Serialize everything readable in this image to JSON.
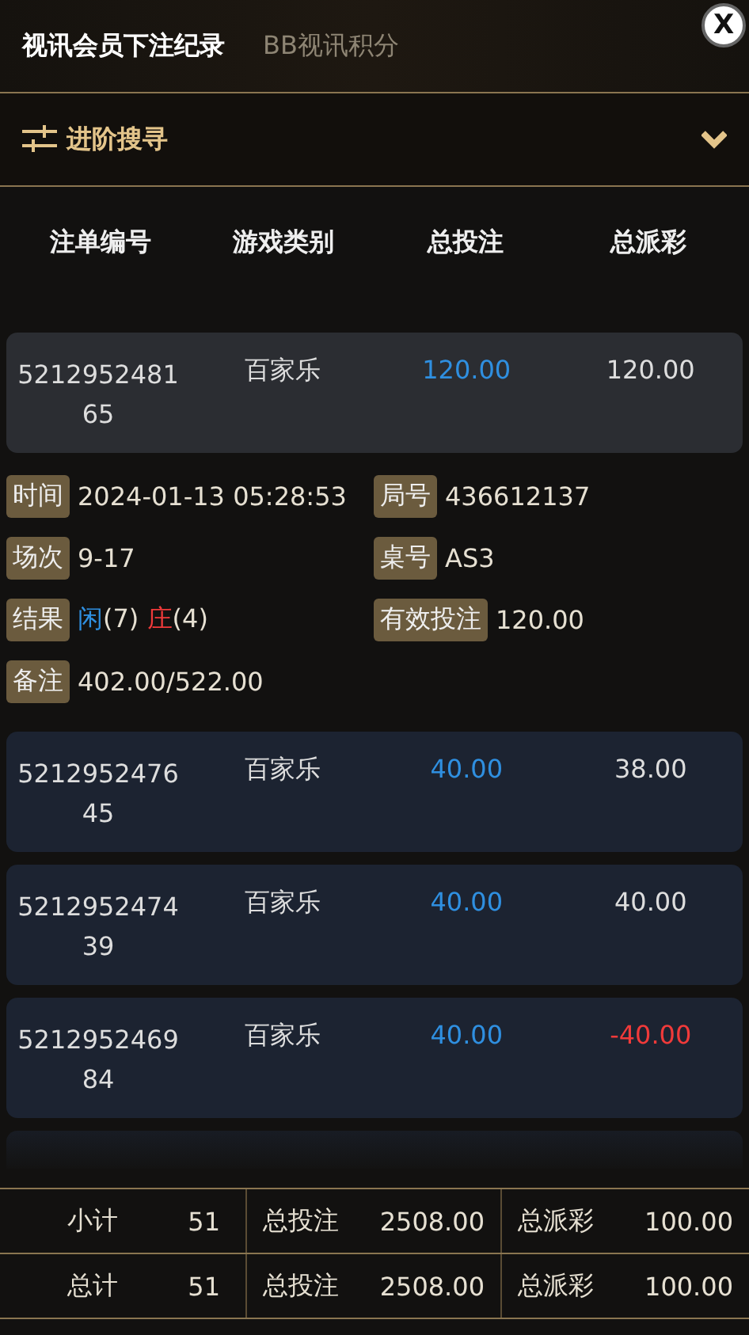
{
  "tabs": [
    {
      "label": "视讯会员下注纪录",
      "selected": true
    },
    {
      "label": "BB视讯积分",
      "selected": false
    }
  ],
  "close_button": {
    "label": "X"
  },
  "filter": {
    "label": "进阶搜寻",
    "expanded": false
  },
  "table": {
    "columns": [
      "注单编号",
      "游戏类别",
      "总投注",
      "总派彩"
    ],
    "rows": [
      {
        "order_id": "521295248165",
        "game": "百家乐",
        "bet": "120.00",
        "payout": "120.00",
        "negative": false,
        "expanded": true,
        "details": [
          {
            "label": "时间",
            "value": "2024-01-13 05:28:53"
          },
          {
            "label": "局号",
            "value": "436612137"
          },
          {
            "label": "场次",
            "value": "9-17"
          },
          {
            "label": "桌号",
            "value": "AS3"
          },
          {
            "label": "结果",
            "kind": "result",
            "results": [
              {
                "color": "#2f8fe0",
                "name": "闲",
                "count": "(7)"
              },
              {
                "color": "#f03a3a",
                "name": "庄",
                "count": "(4)"
              }
            ]
          },
          {
            "label": "有效投注",
            "value": "120.00"
          },
          {
            "label": "备注",
            "value": "402.00/522.00"
          }
        ]
      },
      {
        "order_id": "521295247645",
        "game": "百家乐",
        "bet": "40.00",
        "payout": "38.00",
        "negative": false,
        "expanded": false
      },
      {
        "order_id": "521295247439",
        "game": "百家乐",
        "bet": "40.00",
        "payout": "40.00",
        "negative": false,
        "expanded": false
      },
      {
        "order_id": "521295246984",
        "game": "百家乐",
        "bet": "40.00",
        "payout": "-40.00",
        "negative": true,
        "expanded": false
      }
    ]
  },
  "totals": [
    {
      "label": "小计",
      "count": "51",
      "bet_label": "总投注",
      "bet": "2508.00",
      "payout_label": "总派彩",
      "payout": "100.00"
    },
    {
      "label": "总计",
      "count": "51",
      "bet_label": "总投注",
      "bet": "2508.00",
      "payout_label": "总派彩",
      "payout": "100.00"
    }
  ]
}
